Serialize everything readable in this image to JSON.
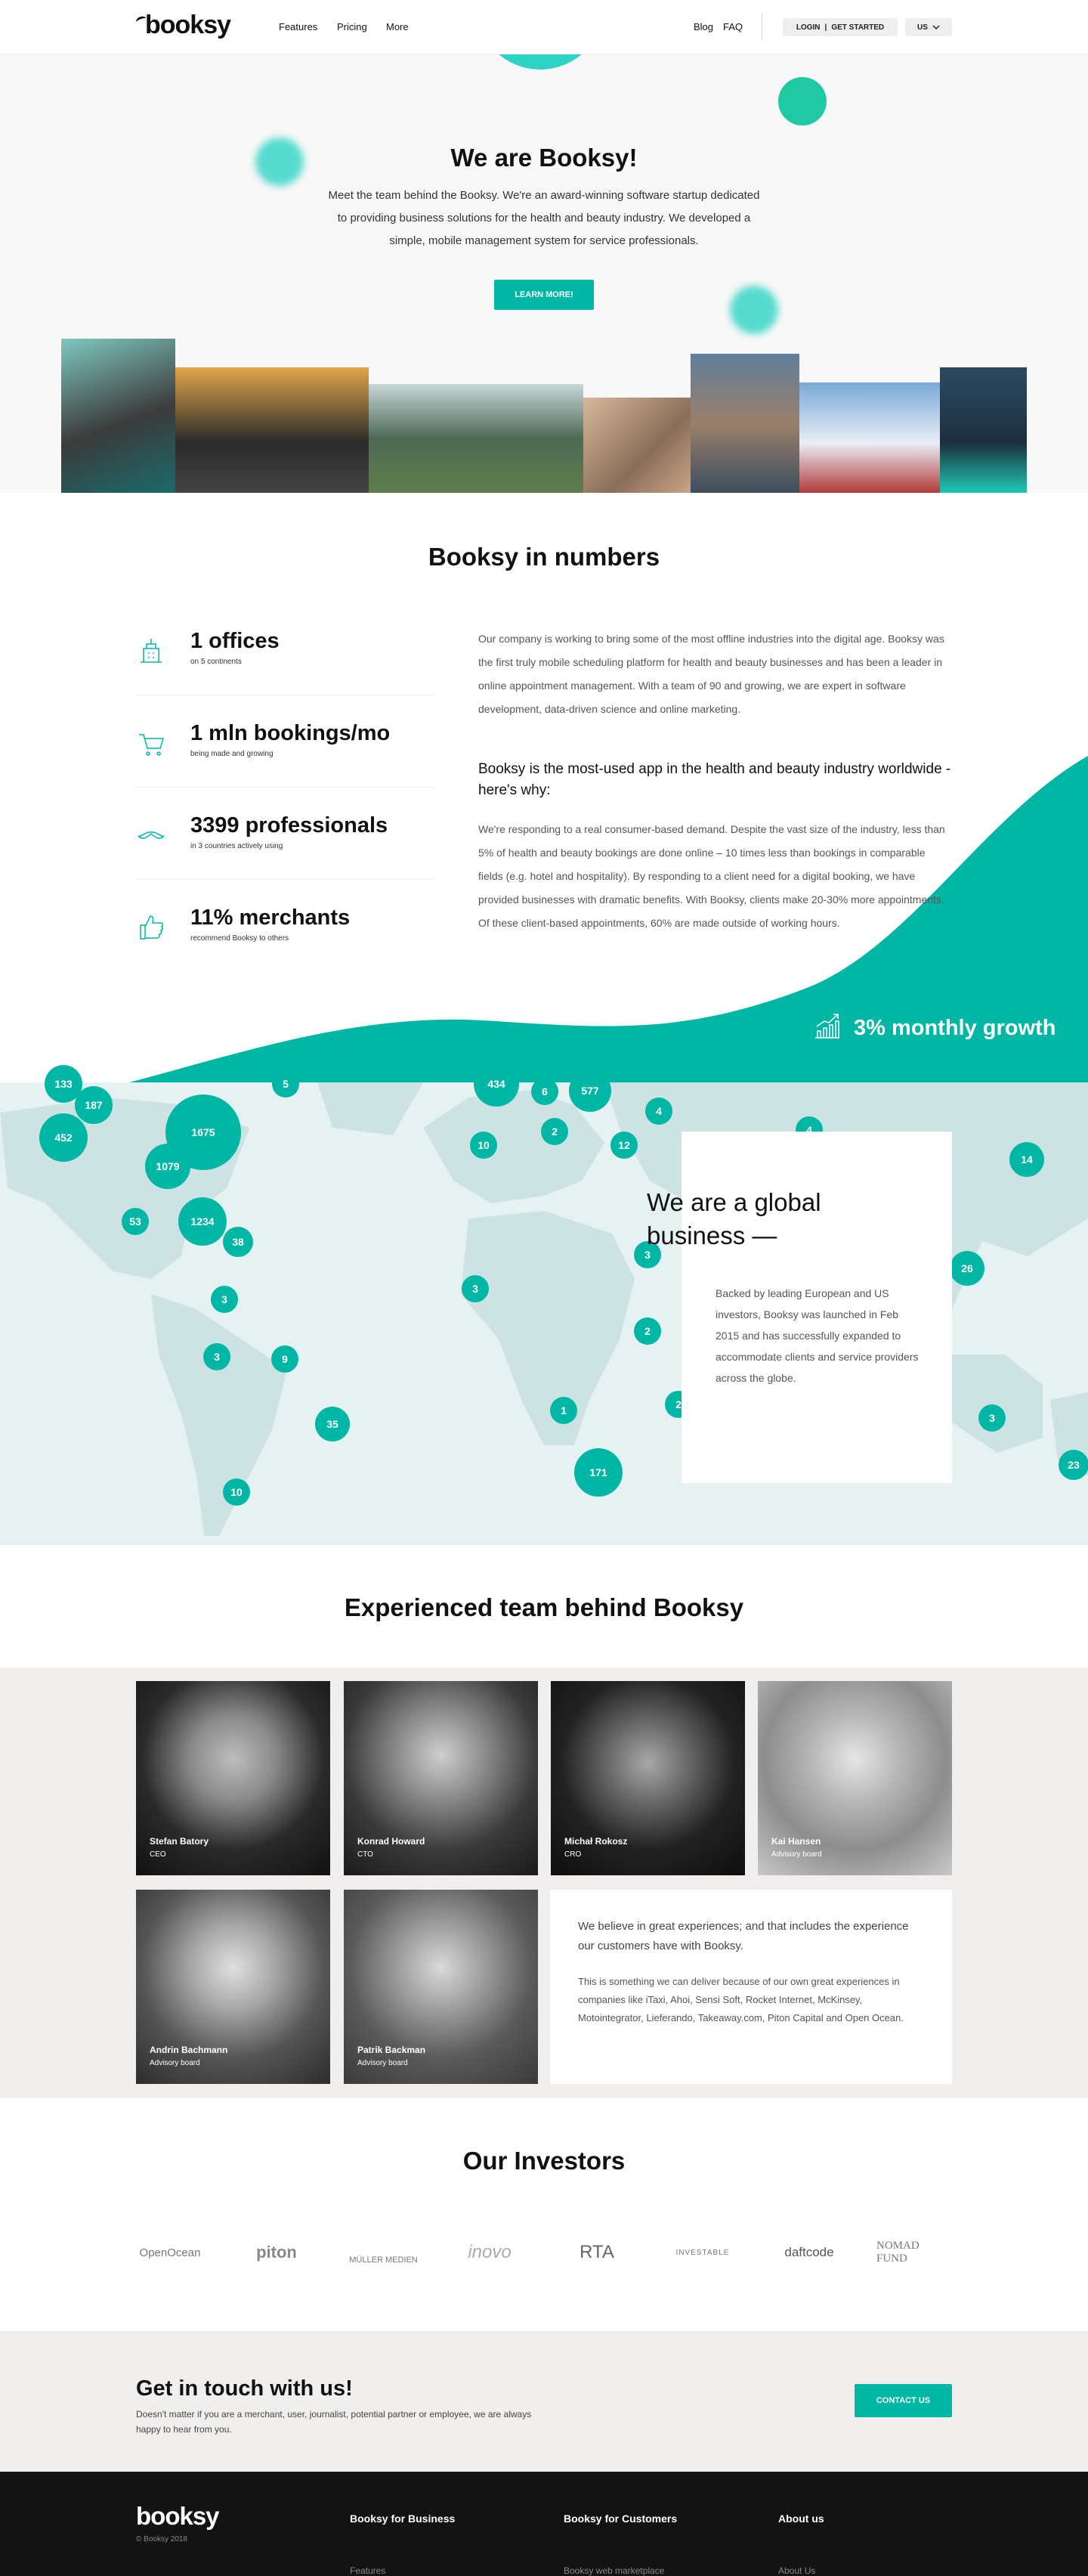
{
  "header": {
    "logo": "booksy",
    "nav": [
      "Features",
      "Pricing",
      "More"
    ],
    "right_links": [
      "Blog",
      "FAQ"
    ],
    "login_label": "LOGIN",
    "separator": "|",
    "get_started_label": "GET STARTED",
    "country": "US",
    "country_icon": "chevron-down-icon"
  },
  "hero": {
    "title": "We are Booksy!",
    "description": "Meet the team behind the Booksy. We're an award-winning software startup dedicated to providing business solutions for the health and beauty industry. We developed a simple, mobile management system for service professionals.",
    "button": "LEARN MORE!"
  },
  "numbers": {
    "title": "Booksy in numbers",
    "stats": [
      {
        "value": "1 offices",
        "caption": "on 5 continents",
        "icon": "building-icon"
      },
      {
        "value": "1 mln bookings/mo",
        "caption": "being made and growing",
        "icon": "cart-icon"
      },
      {
        "value": "3399 professionals",
        "caption": "in 3 countries actively using",
        "icon": "mustache-icon"
      },
      {
        "value": "11% merchants",
        "caption": "recommend Booksy to others",
        "icon": "thumbs-up-icon"
      }
    ],
    "paragraph1": "Our company is working to bring some of the most offline industries into the digital age. Booksy was the first truly mobile scheduling platform for health and beauty businesses and has been a leader in online appointment management. With a team of 90 and growing, we are expert in software development, data-driven science and online marketing.",
    "heading": "Booksy is the most-used app in the health and beauty industry worldwide - here's why:",
    "paragraph2": "We're responding to a real consumer-based demand. Despite the vast size of the industry, less than 5% of health and beauty bookings are done online – 10 times less than bookings in comparable fields (e.g. hotel and hospitality). By responding to a client need for a digital booking, we have provided businesses with dramatic benefits. With Booksy, clients make 20-30% more appointments. Of these client-based appointments, 60% are made outside of working hours.",
    "growth": "3% monthly growth",
    "colors": {
      "accent": "#00b7a5",
      "bubble_light": "#2dd4c4"
    }
  },
  "map": {
    "title": "We are a global business —",
    "description": "Backed by leading European and US investors, Booksy was launched in Feb 2015 and has successfully expanded to accommodate clients and service providers across the globe.",
    "bubbles": [
      "133",
      "187",
      "452",
      "1675",
      "1079",
      "53",
      "1234",
      "38",
      "5",
      "434",
      "6",
      "577",
      "4",
      "2",
      "12",
      "10",
      "3",
      "4",
      "14",
      "3",
      "26",
      "3",
      "3",
      "9",
      "2",
      "35",
      "1",
      "2",
      "171",
      "10",
      "3",
      "23"
    ]
  },
  "team": {
    "title": "Experienced team behind Booksy",
    "members": [
      {
        "name": "Stefan Batory",
        "role": "CEO"
      },
      {
        "name": "Konrad Howard",
        "role": "CTO"
      },
      {
        "name": "Michał Rokosz",
        "role": "CRO"
      },
      {
        "name": "Kai Hansen",
        "role": "Advisory board"
      },
      {
        "name": "Andrin Bachmann",
        "role": "Advisory board"
      },
      {
        "name": "Patrik Backman",
        "role": "Advisory board"
      }
    ],
    "card_intro": "We believe in great experiences; and that includes the experience our customers have with Booksy.",
    "card_body": "This is something we can deliver because of our own great experiences in companies like iTaxi, Ahoi, Sensi Soft, Rocket Internet, McKinsey, Motointegrator, Lieferando, Takeaway.com, Piton Capital and Open Ocean."
  },
  "investors": {
    "title": "Our Investors",
    "logos": [
      "OpenOcean",
      "piton",
      "MÜLLER MEDIEN",
      "inovo",
      "RTA",
      "INVESTABLE",
      "daftcode",
      "NOMAD FUND"
    ]
  },
  "contact": {
    "title": "Get in touch with us!",
    "text": "Doesn't matter if you are a merchant, user, journalist, potential partner or employee, we are always happy to hear from you.",
    "button": "CONTACT US"
  },
  "footer": {
    "logo": "booksy",
    "copyright": "© Booksy 2018",
    "columns": [
      {
        "title": "Booksy for Business",
        "link": "Features"
      },
      {
        "title": "Booksy for Customers",
        "link": "Booksy web marketplace"
      },
      {
        "title": "About us",
        "link": "About Us"
      }
    ]
  }
}
